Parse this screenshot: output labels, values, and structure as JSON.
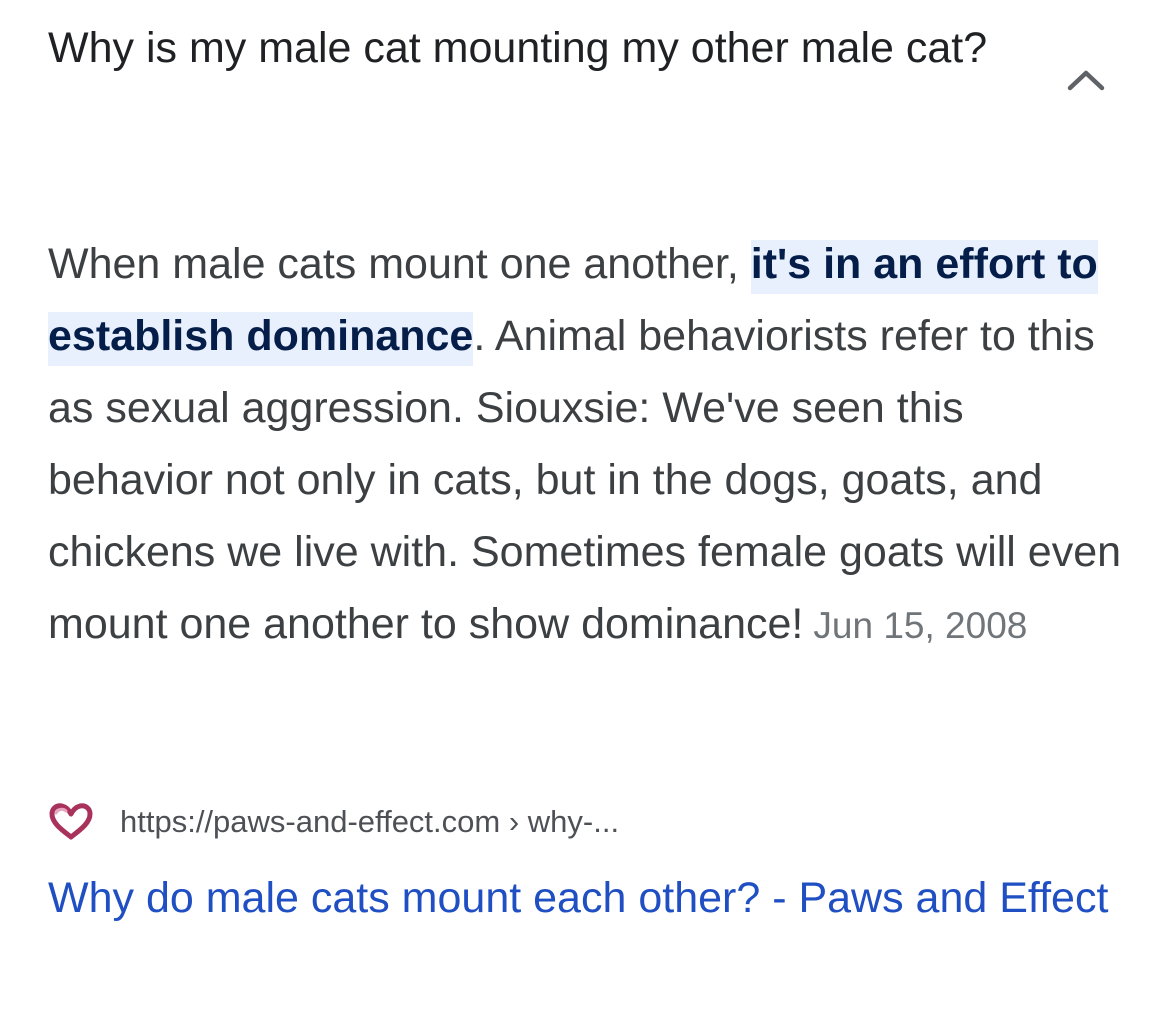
{
  "question": "Why is my male cat mounting my other male cat?",
  "answer": {
    "lead": "When male cats mount one another, ",
    "highlight": "it's in an effort to establish dominance",
    "rest": ". Animal behaviorists refer to this as sexual aggression. Siouxsie: We've seen this behavior not only in cats, but in the dogs, goats, and chickens we live with. Sometimes female goats will even mount one another to show dominance!",
    "date": "Jun 15, 2008"
  },
  "source": {
    "favicon": "heart-icon",
    "url": "https://paws-and-effect.com › why-..."
  },
  "result_title": "Why do male cats mount each other? - Paws and Effect",
  "icons": {
    "collapse": "chevron-up-icon"
  },
  "colors": {
    "link": "#1f4fc2",
    "highlight_bg": "#e8f0fe",
    "favicon": "#a8325c"
  }
}
